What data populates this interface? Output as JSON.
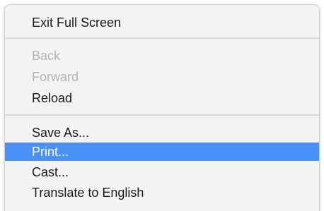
{
  "menu": {
    "items": [
      {
        "label": "Exit Full Screen",
        "enabled": true
      },
      {
        "label": "Back",
        "enabled": false
      },
      {
        "label": "Forward",
        "enabled": false
      },
      {
        "label": "Reload",
        "enabled": true
      },
      {
        "label": "Save As...",
        "enabled": true
      },
      {
        "label": "Print...",
        "enabled": true,
        "highlighted": true
      },
      {
        "label": "Cast...",
        "enabled": true
      },
      {
        "label": "Translate to English",
        "enabled": true
      }
    ]
  },
  "colors": {
    "highlight": "#4a90f7",
    "menu_background": "#f3f3f3",
    "text": "#1a1a1a",
    "disabled_text": "#b3b3b3",
    "separator": "#dadada"
  }
}
